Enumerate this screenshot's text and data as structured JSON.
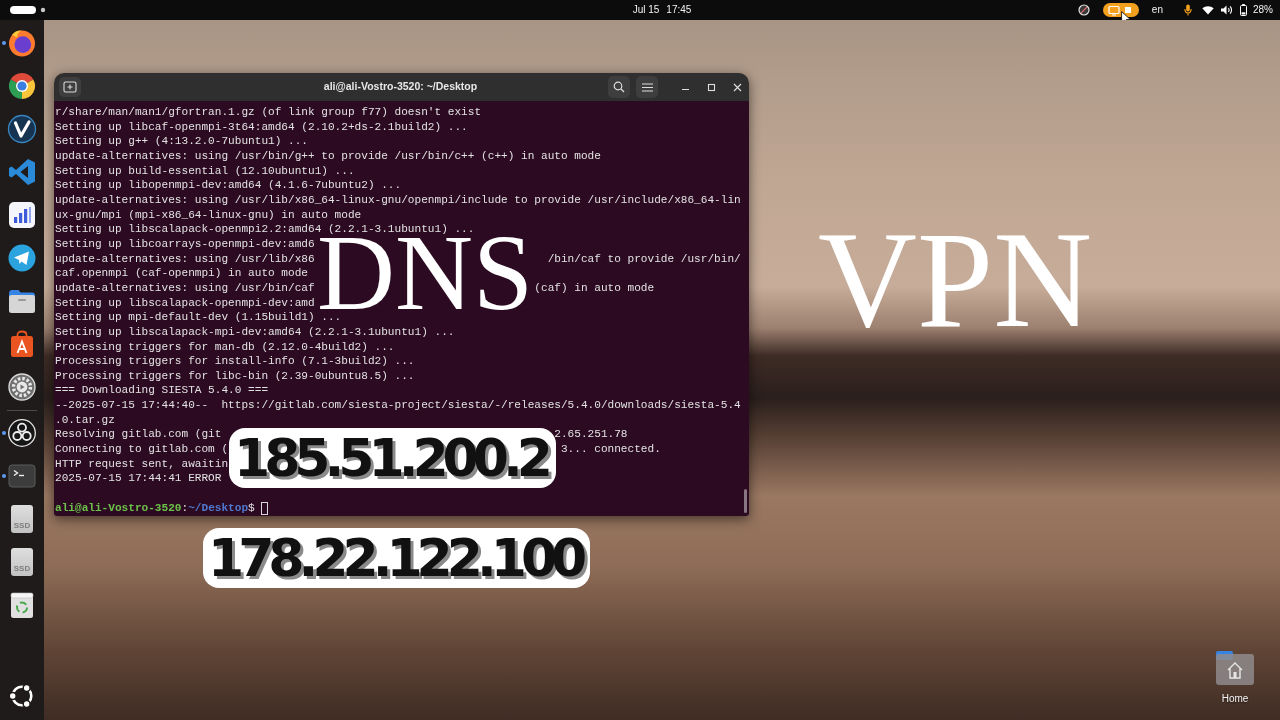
{
  "top_bar": {
    "date": "Jul 15",
    "time": "17:45",
    "input_source": "en",
    "battery": "28%"
  },
  "dock": {
    "items": [
      {
        "kind": "app",
        "running": true
      },
      {
        "kind": "app",
        "running": false
      },
      {
        "kind": "app",
        "running": false
      },
      {
        "kind": "app",
        "running": false
      },
      {
        "kind": "app",
        "running": false
      },
      {
        "kind": "app",
        "running": false
      },
      {
        "kind": "app",
        "running": false
      },
      {
        "kind": "app",
        "running": false
      },
      {
        "kind": "app",
        "running": false
      },
      {
        "kind": "app",
        "running": true
      },
      {
        "kind": "app",
        "running": true
      },
      {
        "kind": "drive",
        "label": "SSD",
        "running": false
      },
      {
        "kind": "drive",
        "label": "SSD",
        "running": false
      },
      {
        "kind": "app",
        "running": false
      }
    ]
  },
  "terminal": {
    "title": "ali@ali-Vostro-3520: ~/Desktop",
    "lines": [
      {
        "text": "r/share/man/man1/gfortran.1.gz (of link group f77) doesn't exist"
      },
      {
        "text": "Setting up libcaf-openmpi-3t64:amd64 (2.10.2+ds-2.1build2) ..."
      },
      {
        "text": "Setting up g++ (4:13.2.0-7ubuntu1) ..."
      },
      {
        "text": "update-alternatives: using /usr/bin/g++ to provide /usr/bin/c++ (c++) in auto mode"
      },
      {
        "text": "Setting up build-essential (12.10ubuntu1) ..."
      },
      {
        "text": "Setting up libopenmpi-dev:amd64 (4.1.6-7ubuntu2) ..."
      },
      {
        "text": "update-alternatives: using /usr/lib/x86_64-linux-gnu/openmpi/include to provide /usr/include/x86_64-lin"
      },
      {
        "text": "ux-gnu/mpi (mpi-x86_64-linux-gnu) in auto mode"
      },
      {
        "text": "Setting up libscalapack-openmpi2.2:amd64 (2.2.1-3.1ubuntu1) ..."
      },
      {
        "text": "Setting up libcoarrays-openmpi-dev:amd6"
      },
      {
        "segments": [
          "update-alternatives: using /usr/lib/x86",
          "/bin/caf to provide /usr/bin/"
        ]
      },
      {
        "text": "caf.openmpi (caf-openmpi) in auto mode"
      },
      {
        "segments": [
          "update-alternatives: using /usr/bin/caf",
          "(caf) in auto mode"
        ]
      },
      {
        "text": "Setting up libscalapack-openmpi-dev:amd"
      },
      {
        "text": "Setting up mpi-default-dev (1.15build1) ..."
      },
      {
        "text": "Setting up libscalapack-mpi-dev:amd64 (2.2.1-3.1ubuntu1) ..."
      },
      {
        "text": "Processing triggers for man-db (2.12.0-4build2) ..."
      },
      {
        "text": "Processing triggers for install-info (7.1-3build2) ..."
      },
      {
        "text": "Processing triggers for libc-bin (2.39-0ubuntu8.5) ..."
      },
      {
        "text": "=== Downloading SIESTA 5.4.0 ==="
      },
      {
        "text": "--2025-07-15 17:44:40--  https://gitlab.com/siesta-project/siesta/-/releases/5.4.0/downloads/siesta-5.4"
      },
      {
        "text": ".0.tar.gz"
      },
      {
        "segments": [
          "Resolving gitlab.com (git",
          "2.65.251.78"
        ]
      },
      {
        "segments": [
          "Connecting to gitlab.com (",
          "3... connected."
        ]
      },
      {
        "text": "HTTP request sent, awaitin"
      },
      {
        "text": "2025-07-15 17:44:41 ERROR"
      }
    ],
    "prompt": {
      "user_host": "ali@ali-Vostro-3520",
      "separator": ":",
      "path": "~/Desktop",
      "symbol": "$"
    }
  },
  "overlays": [
    {
      "kind": "serif",
      "text": "DNS"
    },
    {
      "kind": "serif",
      "text": "VPN"
    },
    {
      "kind": "outlined",
      "text": "185.51.200.2"
    },
    {
      "kind": "outlined",
      "text": "178.22.122.100"
    }
  ],
  "desktop_icons": [
    {
      "label": "Home"
    }
  ]
}
